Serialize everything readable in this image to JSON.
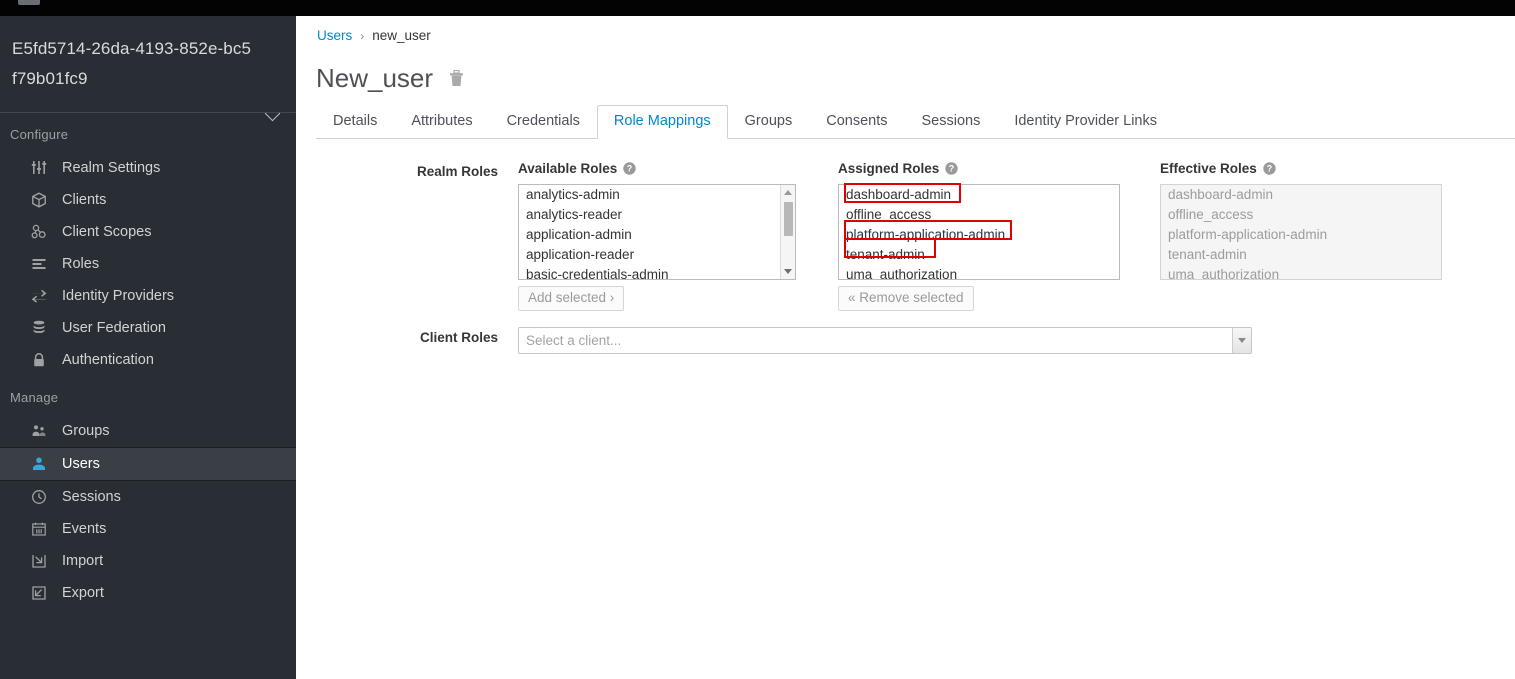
{
  "sidebar": {
    "realm_name": "E5fd5714-26da-4193-852e-bc5f79b01fc9",
    "sections": [
      {
        "title": "Configure",
        "items": [
          {
            "label": "Realm Settings",
            "icon": "sliders-icon",
            "active": false
          },
          {
            "label": "Clients",
            "icon": "cube-icon",
            "active": false
          },
          {
            "label": "Client Scopes",
            "icon": "molecule-icon",
            "active": false
          },
          {
            "label": "Roles",
            "icon": "list-bars-icon",
            "active": false
          },
          {
            "label": "Identity Providers",
            "icon": "exchange-arrows-icon",
            "active": false
          },
          {
            "label": "User Federation",
            "icon": "database-icon",
            "active": false
          },
          {
            "label": "Authentication",
            "icon": "lock-icon",
            "active": false
          }
        ]
      },
      {
        "title": "Manage",
        "items": [
          {
            "label": "Groups",
            "icon": "users-group-icon",
            "active": false
          },
          {
            "label": "Users",
            "icon": "user-icon",
            "active": true
          },
          {
            "label": "Sessions",
            "icon": "clock-icon",
            "active": false
          },
          {
            "label": "Events",
            "icon": "calendar-icon",
            "active": false
          },
          {
            "label": "Import",
            "icon": "import-arrow-icon",
            "active": false
          },
          {
            "label": "Export",
            "icon": "export-arrow-icon",
            "active": false
          }
        ]
      }
    ]
  },
  "breadcrumb": {
    "root": "Users",
    "separator": "›",
    "current": "new_user"
  },
  "page": {
    "title": "New_user",
    "delete_icon": "trash-icon"
  },
  "tabs": [
    {
      "label": "Details",
      "active": false
    },
    {
      "label": "Attributes",
      "active": false
    },
    {
      "label": "Credentials",
      "active": false
    },
    {
      "label": "Role Mappings",
      "active": true
    },
    {
      "label": "Groups",
      "active": false
    },
    {
      "label": "Consents",
      "active": false
    },
    {
      "label": "Sessions",
      "active": false
    },
    {
      "label": "Identity Provider Links",
      "active": false
    }
  ],
  "realm_roles": {
    "row_label": "Realm Roles",
    "available": {
      "label": "Available Roles",
      "help_icon": "help-circle-icon",
      "options": [
        "analytics-admin",
        "analytics-reader",
        "application-admin",
        "application-reader",
        "basic-credentials-admin"
      ],
      "button_label": "Add selected ›"
    },
    "assigned": {
      "label": "Assigned Roles",
      "help_icon": "help-circle-icon",
      "options": [
        "dashboard-admin",
        "offline_access",
        "platform-application-admin",
        "tenant-admin",
        "uma_authorization"
      ],
      "highlighted": [
        "dashboard-admin",
        "platform-application-admin",
        "tenant-admin"
      ],
      "highlight_color": "#e00000",
      "button_label": "« Remove selected"
    },
    "effective": {
      "label": "Effective Roles",
      "help_icon": "help-circle-icon",
      "options": [
        "dashboard-admin",
        "offline_access",
        "platform-application-admin",
        "tenant-admin",
        "uma_authorization"
      ]
    }
  },
  "client_roles": {
    "row_label": "Client Roles",
    "select_placeholder": "Select a client...",
    "select_value": "",
    "dropdown_icon": "caret-down-icon"
  },
  "colors": {
    "sidebar_bg": "#292e34",
    "accent_link": "#0088ce",
    "highlight": "#e00000",
    "active_nav_icon": "#39a5dc"
  }
}
